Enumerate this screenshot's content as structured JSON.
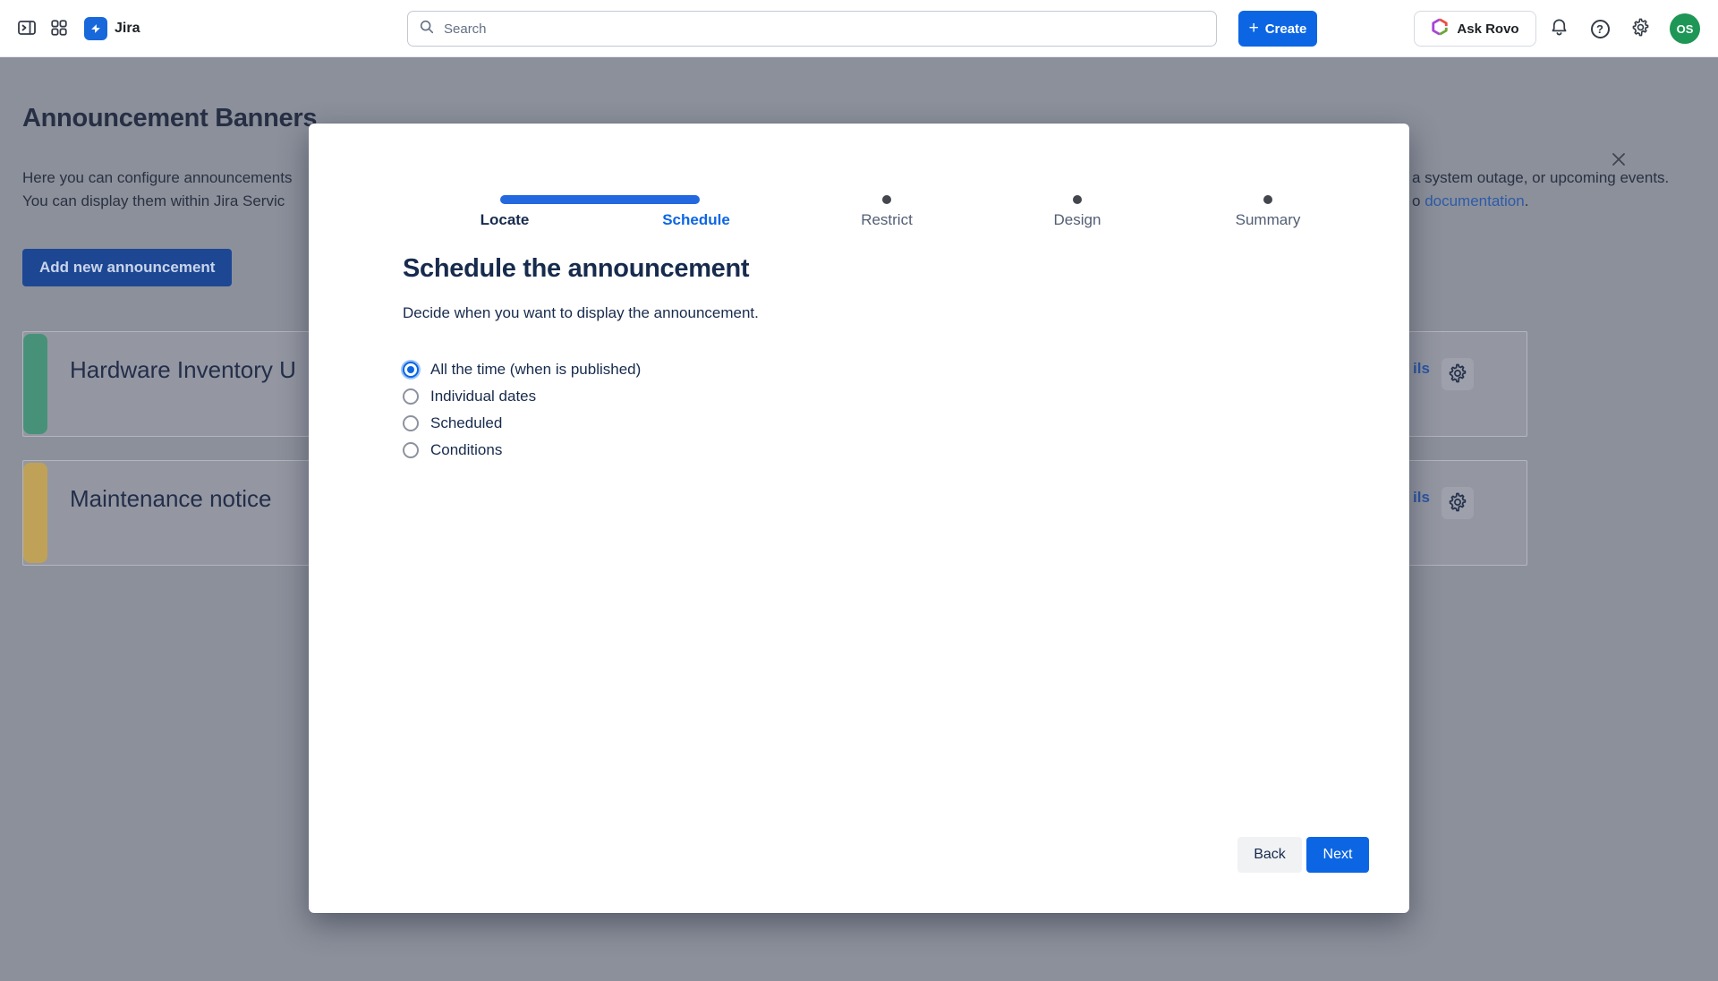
{
  "header": {
    "app_name": "Jira",
    "search_placeholder": "Search",
    "create_label": "Create",
    "ask_rovo_label": "Ask Rovo",
    "avatar_initials": "OS"
  },
  "page": {
    "title": "Announcement Banners",
    "intro_line1_left": "Here you can configure announcements",
    "intro_line2_left": "You can display them within Jira Servic",
    "intro_line1_right": "a system outage, or upcoming events.",
    "intro_line2_right_prefix": "o ",
    "intro_line2_right_link": "documentation",
    "intro_line2_right_suffix": ".",
    "add_button_label": "Add new announcement",
    "banners": [
      {
        "title": "Hardware Inventory U",
        "accent_color": "#479178",
        "details_fragment": "ils"
      },
      {
        "title": "Maintenance notice",
        "accent_color": "#BFA258",
        "details_fragment": "ils"
      }
    ]
  },
  "modal": {
    "steps": [
      {
        "label": "Locate",
        "state": "done"
      },
      {
        "label": "Schedule",
        "state": "current"
      },
      {
        "label": "Restrict",
        "state": "todo"
      },
      {
        "label": "Design",
        "state": "todo"
      },
      {
        "label": "Summary",
        "state": "todo"
      }
    ],
    "title": "Schedule the announcement",
    "subtitle": "Decide when you want to display the announcement.",
    "options": [
      {
        "label": "All the time (when is published)",
        "selected": true
      },
      {
        "label": "Individual dates",
        "selected": false
      },
      {
        "label": "Scheduled",
        "selected": false
      },
      {
        "label": "Conditions",
        "selected": false
      }
    ],
    "back_label": "Back",
    "next_label": "Next"
  },
  "colors": {
    "accent_blue": "#0C66E4",
    "progress_blue": "#2368DE",
    "overlay_background": "#8C909B",
    "banner_green": "#479178",
    "banner_yellow": "#BFA258",
    "avatar_green": "#1E9655"
  }
}
